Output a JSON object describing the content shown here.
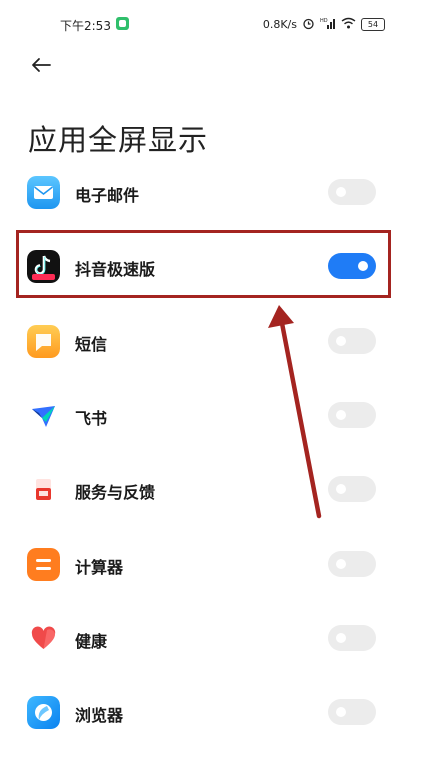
{
  "status_bar": {
    "time": "下午2:53",
    "net_speed": "0.8K/s",
    "alarm_icon": "alarm-icon",
    "signal_label": "HD",
    "wifi_icon": "wifi-icon",
    "battery": "54"
  },
  "header": {
    "back_icon": "back-arrow-icon",
    "title": "应用全屏显示"
  },
  "apps": [
    {
      "label": "电子邮件",
      "enabled": false,
      "icon": "email-app-icon"
    },
    {
      "label": "抖音极速版",
      "enabled": true,
      "icon": "douyin-lite-app-icon"
    },
    {
      "label": "短信",
      "enabled": false,
      "icon": "messages-app-icon"
    },
    {
      "label": "飞书",
      "enabled": false,
      "icon": "feishu-app-icon"
    },
    {
      "label": "服务与反馈",
      "enabled": false,
      "icon": "service-feedback-app-icon"
    },
    {
      "label": "计算器",
      "enabled": false,
      "icon": "calculator-app-icon"
    },
    {
      "label": "健康",
      "enabled": false,
      "icon": "health-app-icon"
    },
    {
      "label": "浏览器",
      "enabled": false,
      "icon": "browser-app-icon"
    }
  ],
  "annotation": {
    "highlight_color": "#a42420",
    "highlighted_app": "抖音极速版"
  },
  "colors": {
    "toggle_on": "#1f7cf6",
    "toggle_off": "#ececec"
  }
}
